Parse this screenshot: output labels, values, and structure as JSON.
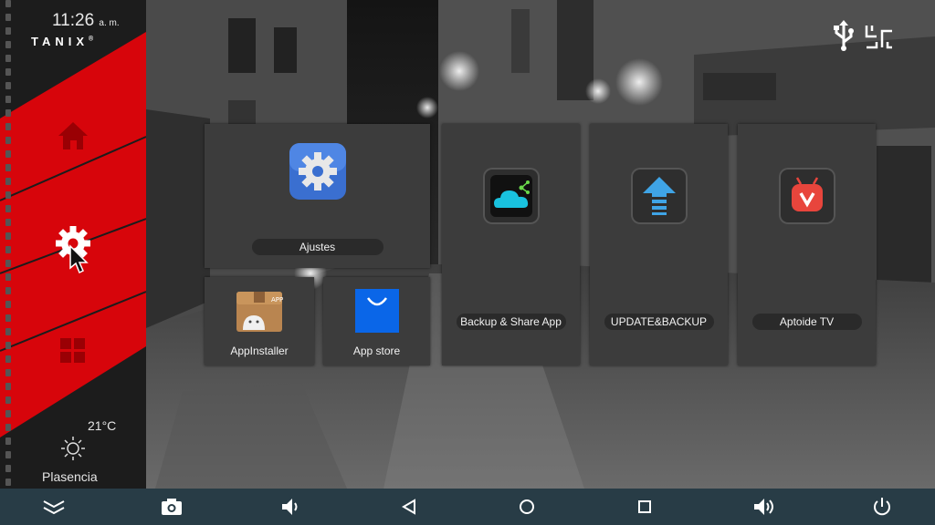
{
  "clock": {
    "time": "11:26",
    "ampm": "a. m."
  },
  "brand": {
    "name": "TANIX",
    "mark": "®"
  },
  "sidebar": {
    "items": [
      {
        "name": "home",
        "icon": "home-icon"
      },
      {
        "name": "settings",
        "icon": "gear-icon"
      },
      {
        "name": "apps",
        "icon": "apps-grid-icon"
      }
    ]
  },
  "weather": {
    "temperature": "21°C",
    "city": "Plasencia",
    "icon": "sun-icon"
  },
  "status_icons": [
    "usb-icon",
    "ethernet-icon"
  ],
  "tiles": [
    {
      "id": "ajustes",
      "label": "Ajustes",
      "icon": "settings-app-icon"
    },
    {
      "id": "appinstaller",
      "label": "AppInstaller",
      "icon": "appinstaller-icon"
    },
    {
      "id": "appstore",
      "label": "App store",
      "icon": "shopping-bag-icon"
    },
    {
      "id": "backup",
      "label": "Backup & Share App",
      "icon": "cloud-icon"
    },
    {
      "id": "update",
      "label": "UPDATE&BACKUP",
      "icon": "upload-arrow-icon"
    },
    {
      "id": "aptoide",
      "label": "Aptoide TV",
      "icon": "aptoide-icon"
    }
  ],
  "navbar": [
    "collapse-icon",
    "screenshot-camera-icon",
    "volume-down-icon",
    "back-icon",
    "home-circle-icon",
    "recents-icon",
    "volume-up-icon",
    "power-icon"
  ],
  "colors": {
    "accent_red": "#d7050b",
    "navbar": "#283c46",
    "tile": "#3c3c3c"
  }
}
